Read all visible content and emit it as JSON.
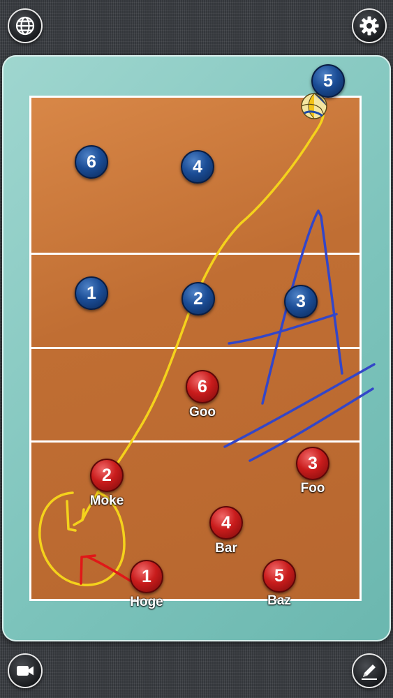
{
  "toolbar": {
    "language_icon": "globe-icon",
    "settings_icon": "gear-icon",
    "record_icon": "video-camera-icon",
    "draw_icon": "pencil-icon"
  },
  "colors": {
    "blue_team": "#1b4d96",
    "red_team": "#c91c1c",
    "court": "#c06e33",
    "board": "#7cc3bb",
    "pen_yellow": "#f4d21c",
    "pen_blue": "#3346c8",
    "pen_red": "#e01818"
  },
  "blue_team": {
    "p5": "5",
    "p6": "6",
    "p4": "4",
    "p1": "1",
    "p2": "2",
    "p3": "3"
  },
  "red_team": {
    "p6": {
      "number": "6",
      "name": "Goo"
    },
    "p2": {
      "number": "2",
      "name": "Moke"
    },
    "p3": {
      "number": "3",
      "name": "Foo"
    },
    "p4": {
      "number": "4",
      "name": "Bar"
    },
    "p1": {
      "number": "1",
      "name": "Hoge"
    },
    "p5": {
      "number": "5",
      "name": "Baz"
    }
  }
}
